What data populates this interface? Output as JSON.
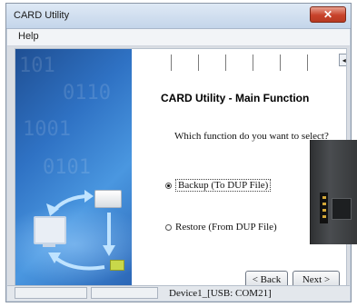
{
  "window": {
    "title": "CARD Utility",
    "close_label": "✕"
  },
  "menu": {
    "items": [
      "Help"
    ]
  },
  "page": {
    "heading": "CARD Utility - Main Function",
    "question": "Which function do you want to select?",
    "options": [
      {
        "label": "Backup (To DUP File)",
        "selected": true
      },
      {
        "label": "Restore (From DUP File)",
        "selected": false
      }
    ],
    "back_label": "< Back",
    "next_label": "Next >"
  },
  "statusbar": {
    "connection": "Device1_[USB: COM21]"
  },
  "icons": {
    "scroll_left": "◂",
    "scroll_right": "▸"
  }
}
